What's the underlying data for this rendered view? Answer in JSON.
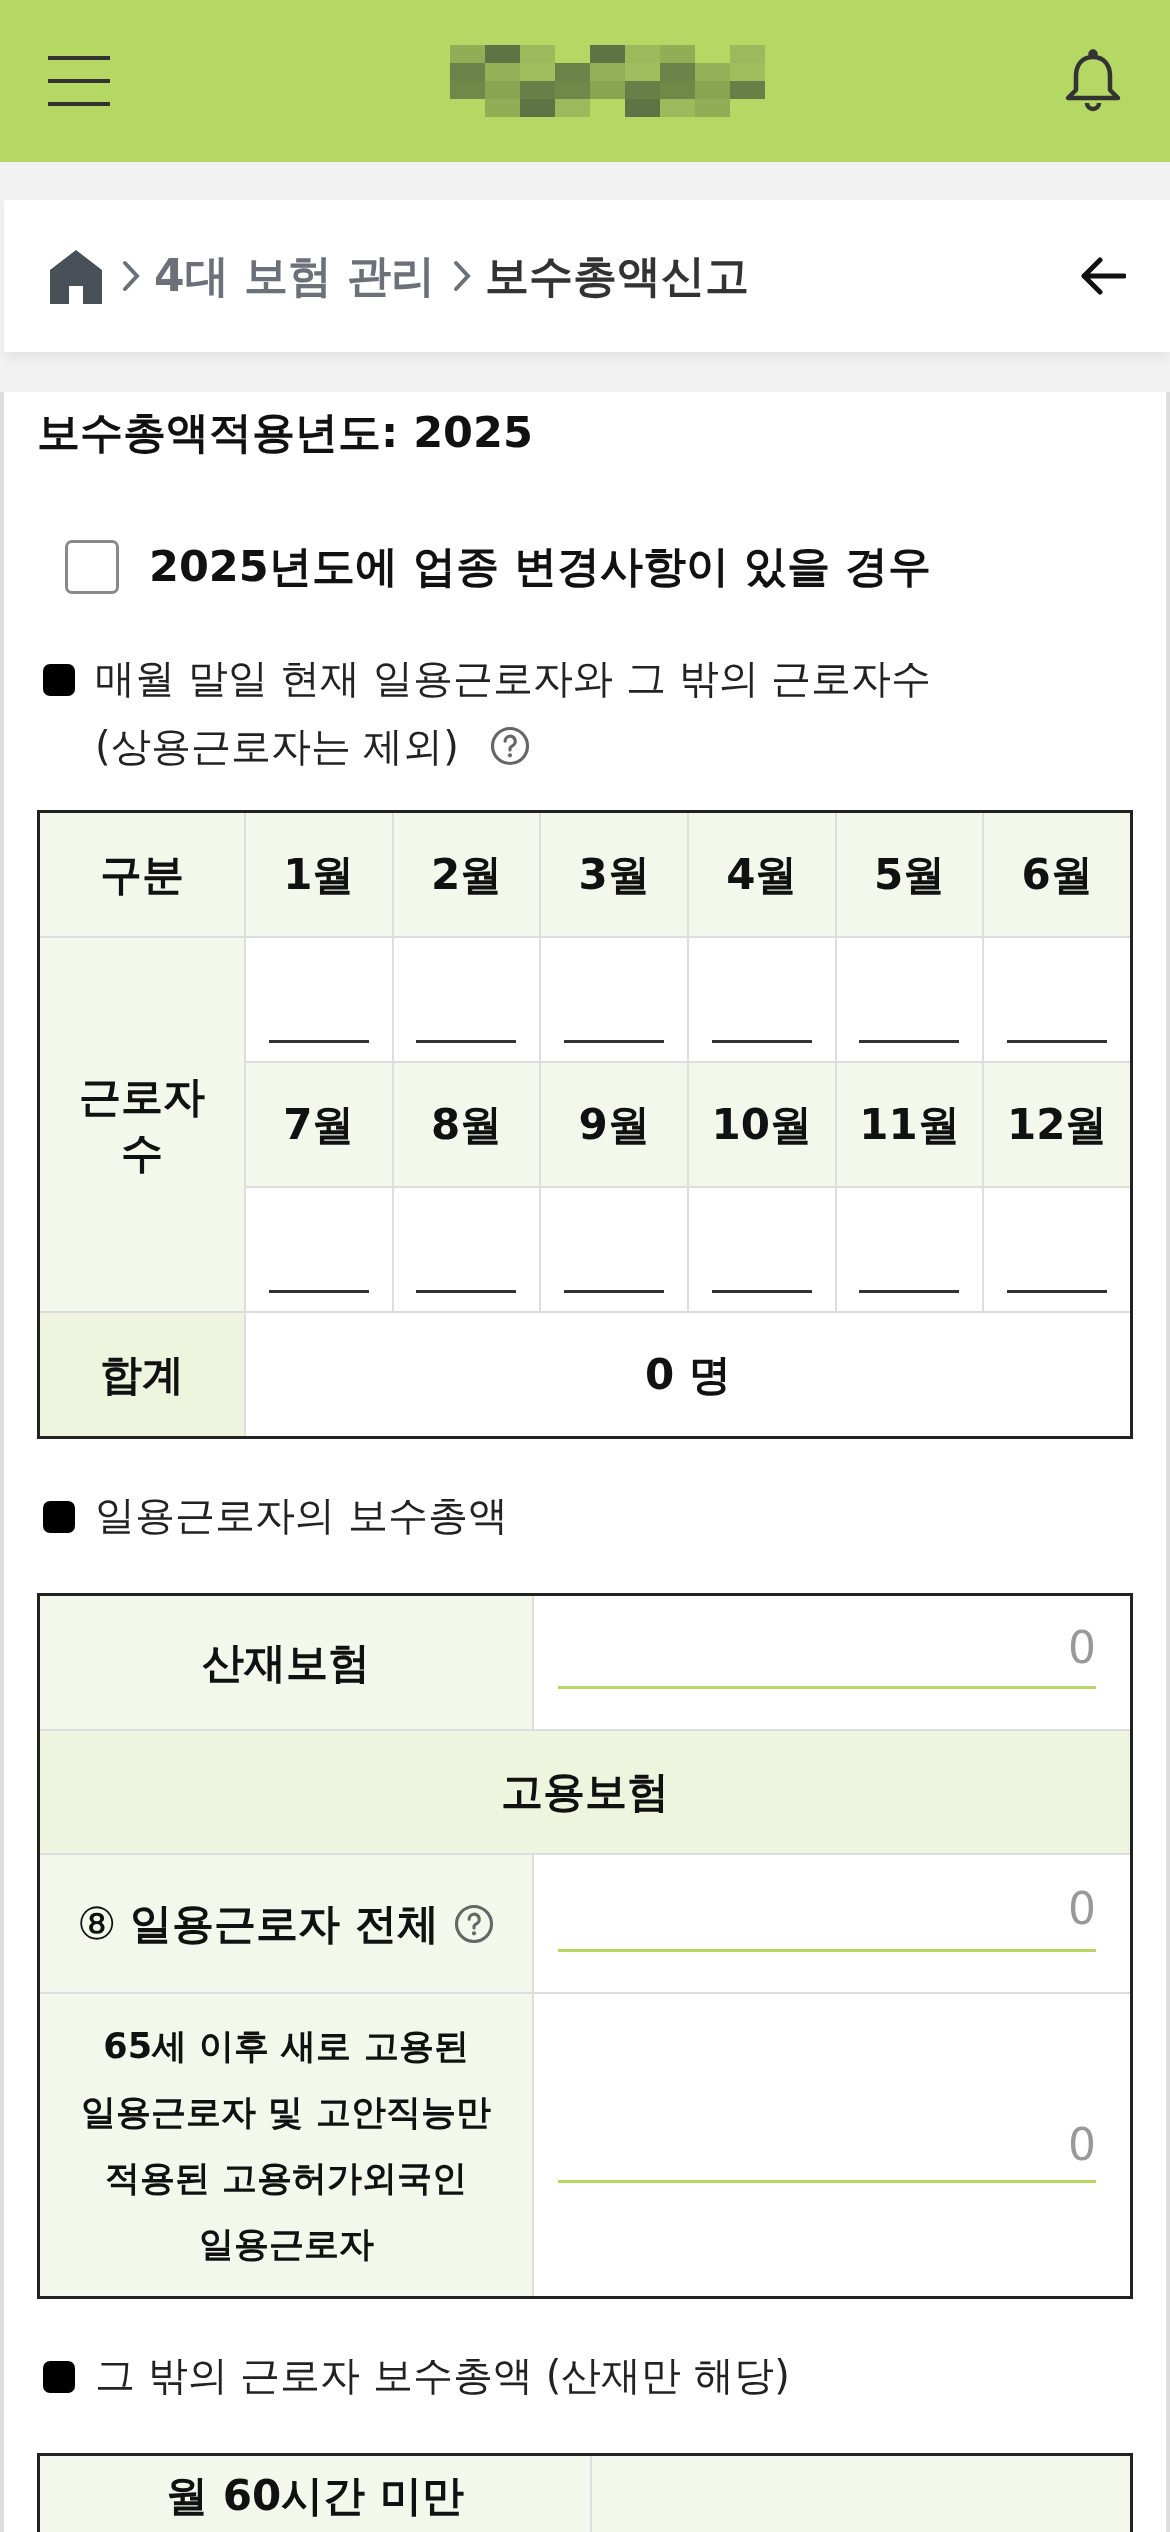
{
  "breadcrumb": [
    {
      "label": "4대 보험 관리",
      "current": false
    },
    {
      "label": "보수총액신고",
      "current": true
    }
  ],
  "year_title": "보수총액적용년도: 2025",
  "industry_change": {
    "label": "2025년도에 업종 변경사항이 있을 경우",
    "checked": false
  },
  "worker_count": {
    "title": "매월 말일 현재 일용근로자와 그 밖의 근로자수",
    "subtitle": "(상용근로자는 제외)",
    "help": true,
    "corner_header": "구분",
    "row_label": "근로자 수",
    "months": [
      "1월",
      "2월",
      "3월",
      "4월",
      "5월",
      "6월",
      "7월",
      "8월",
      "9월",
      "10월",
      "11월",
      "12월"
    ],
    "total_label": "합계",
    "total_value": "0 명"
  },
  "daily_wages": {
    "title": "일용근로자의 보수총액",
    "rows": [
      {
        "kind": "field",
        "label": "산재보험",
        "placeholder": "0"
      },
      {
        "kind": "heading",
        "label": "고용보험"
      },
      {
        "kind": "field",
        "marker": "⑧",
        "label": "일용근로자 전체",
        "help": true,
        "placeholder": "0"
      },
      {
        "kind": "field",
        "label": "65세 이후 새로 고용된 일용근로자 및 고안직능만 적용된 고용허가외국인 일용근로자",
        "placeholder": "0",
        "small": true
      }
    ]
  },
  "other_wages": {
    "title": "그 밖의 근로자 보수총액 (산재만 해당)",
    "column_1": "월 60시간 미만"
  }
}
